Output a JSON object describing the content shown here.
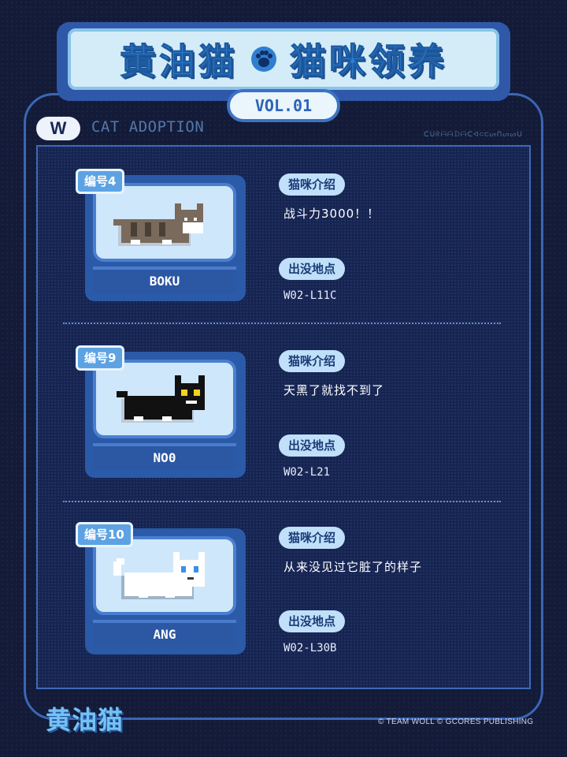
{
  "header": {
    "title_left": "黄油猫",
    "title_right": "猫咪领养",
    "volume": "VOL.01",
    "logo_letter": "W",
    "section_label": "CAT ADOPTION",
    "code_text": "ᑕᑌᖇᗩᗩᗪᗩᑕᐊ⊂⊏ᔕᑎᔕᔕᑌ"
  },
  "labels": {
    "intro": "猫咪介绍",
    "location": "出没地点"
  },
  "cats": [
    {
      "number": "编号4",
      "name": "BOKU",
      "description": "战斗力3000！！",
      "location": "W02-L11C",
      "color": "#7a6a5c",
      "eye": "#ffffff"
    },
    {
      "number": "编号9",
      "name": "NO0",
      "description": "天黑了就找不到了",
      "location": "W02-L21",
      "color": "#111111",
      "eye": "#f2d21c"
    },
    {
      "number": "编号10",
      "name": "ANG",
      "description": "从来没见过它脏了的样子",
      "location": "W02-L30B",
      "color": "#ffffff",
      "eye": "#3b8fe6"
    }
  ],
  "footer": {
    "logo": "黄油猫",
    "copyright": "© TEAM WOLL  © GCORES PUBLISHING"
  },
  "colors": {
    "background": "#131b38",
    "accent": "#2f7fd0",
    "pill": "#bfe0f8"
  }
}
